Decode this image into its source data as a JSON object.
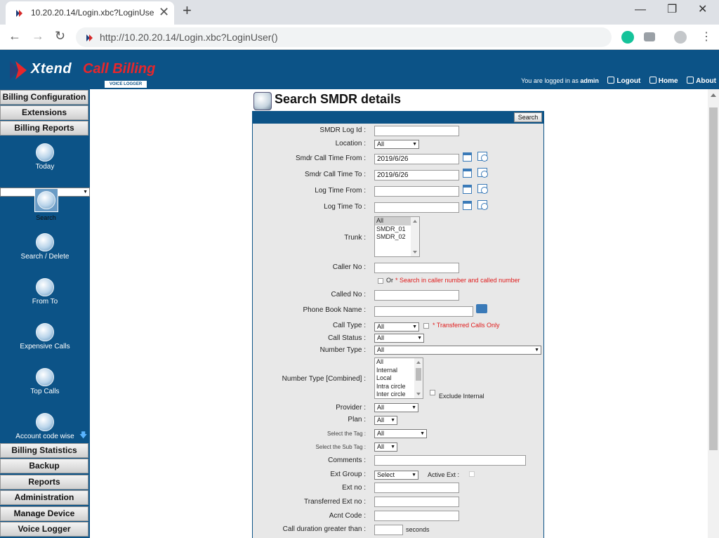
{
  "browser": {
    "tab_title": "10.20.20.14/Login.xbc?LoginUser()",
    "url": "http://10.20.20.14/Login.xbc?LoginUser()",
    "new_tab": "+",
    "close": "✕"
  },
  "header": {
    "logo_main": "Xtend",
    "logo_call_billing": "Call Billing",
    "logo_sub": "VOICE LOGGER",
    "logged_in_prefix": "You are logged in as",
    "user": "admin",
    "logout": "Logout",
    "home": "Home",
    "about": "About"
  },
  "sidebar": {
    "top_menus": [
      "Billing Configuration",
      "Extensions",
      "Billing Reports"
    ],
    "items": [
      {
        "label": "Today",
        "icon": "today-report-icon"
      },
      {
        "label": "Search",
        "icon": "search-report-icon"
      },
      {
        "label": "Search / Delete",
        "icon": "search-delete-icon"
      },
      {
        "label": "From To",
        "icon": "from-to-icon"
      },
      {
        "label": "Expensive Calls",
        "icon": "expensive-calls-icon"
      },
      {
        "label": "Top Calls",
        "icon": "top-calls-icon"
      },
      {
        "label": "Account code wise",
        "icon": "account-code-icon"
      }
    ],
    "bottom_menus": [
      "Billing Statistics",
      "Backup",
      "Reports",
      "Administration",
      "Manage Device",
      "Voice Logger"
    ]
  },
  "page": {
    "title": "Search SMDR details",
    "search_button": "Search"
  },
  "form": {
    "smdr_log_id": {
      "label": "SMDR Log Id :",
      "value": ""
    },
    "location": {
      "label": "Location :",
      "value": "All"
    },
    "smdr_from": {
      "label": "Smdr Call Time From :",
      "value": "2019/6/26"
    },
    "smdr_to": {
      "label": "Smdr Call Time To :",
      "value": "2019/6/26"
    },
    "log_from": {
      "label": "Log Time From :",
      "value": ""
    },
    "log_to": {
      "label": "Log Time To :",
      "value": ""
    },
    "trunk": {
      "label": "Trunk :",
      "options": [
        "All",
        "SMDR_01",
        "SMDR_02"
      ]
    },
    "caller_no": {
      "label": "Caller No :",
      "value": ""
    },
    "or_label": "Or",
    "or_note": "* Search in caller number and called number",
    "called_no": {
      "label": "Called No :",
      "value": ""
    },
    "phone_book": {
      "label": "Phone Book Name :",
      "value": ""
    },
    "call_type": {
      "label": "Call Type :",
      "value": "All"
    },
    "transferred_note": "* Transferred Calls Only",
    "call_status": {
      "label": "Call Status :",
      "value": "All"
    },
    "number_type": {
      "label": "Number Type :",
      "value": "All"
    },
    "number_type_combined": {
      "label": "Number Type [Combined] :",
      "options": [
        "All",
        "Internal",
        "Local",
        "Intra circle",
        "Inter circle"
      ]
    },
    "exclude_internal": "Exclude Internal",
    "provider": {
      "label": "Provider :",
      "value": "All"
    },
    "plan": {
      "label": "Plan :",
      "value": "All"
    },
    "tag": {
      "label": "Select the Tag :",
      "value": "All"
    },
    "sub_tag": {
      "label": "Select the Sub Tag :",
      "value": "All"
    },
    "comments": {
      "label": "Comments :",
      "value": ""
    },
    "ext_group": {
      "label": "Ext Group :",
      "value": "Select"
    },
    "active_ext": "Active Ext :",
    "ext_no": {
      "label": "Ext no :",
      "value": ""
    },
    "transferred_ext": {
      "label": "Transferred Ext no :",
      "value": ""
    },
    "acnt_code": {
      "label": "Acnt Code :",
      "value": ""
    },
    "call_duration": {
      "label": "Call duration greater than :",
      "value": "",
      "unit": "seconds"
    }
  }
}
